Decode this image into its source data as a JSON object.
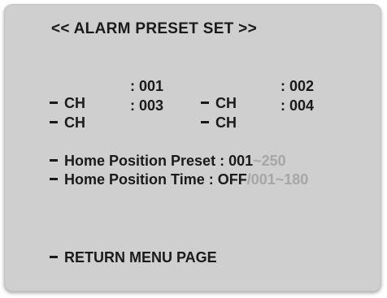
{
  "menu": {
    "title": "<< ALARM PRESET SET >>",
    "channels": [
      {
        "label": "CH",
        "value": ": 001"
      },
      {
        "label": "CH",
        "value": ": 002"
      },
      {
        "label": "CH",
        "value": ": 003"
      },
      {
        "label": "CH",
        "value": ": 004"
      }
    ],
    "home_position_preset": {
      "label": "Home Position Preset :",
      "value": "001",
      "range": "~250"
    },
    "home_position_time": {
      "label": "Home Position Time :",
      "value": "OFF",
      "range": "/001~180"
    },
    "return_label": "RETURN MENU PAGE"
  }
}
